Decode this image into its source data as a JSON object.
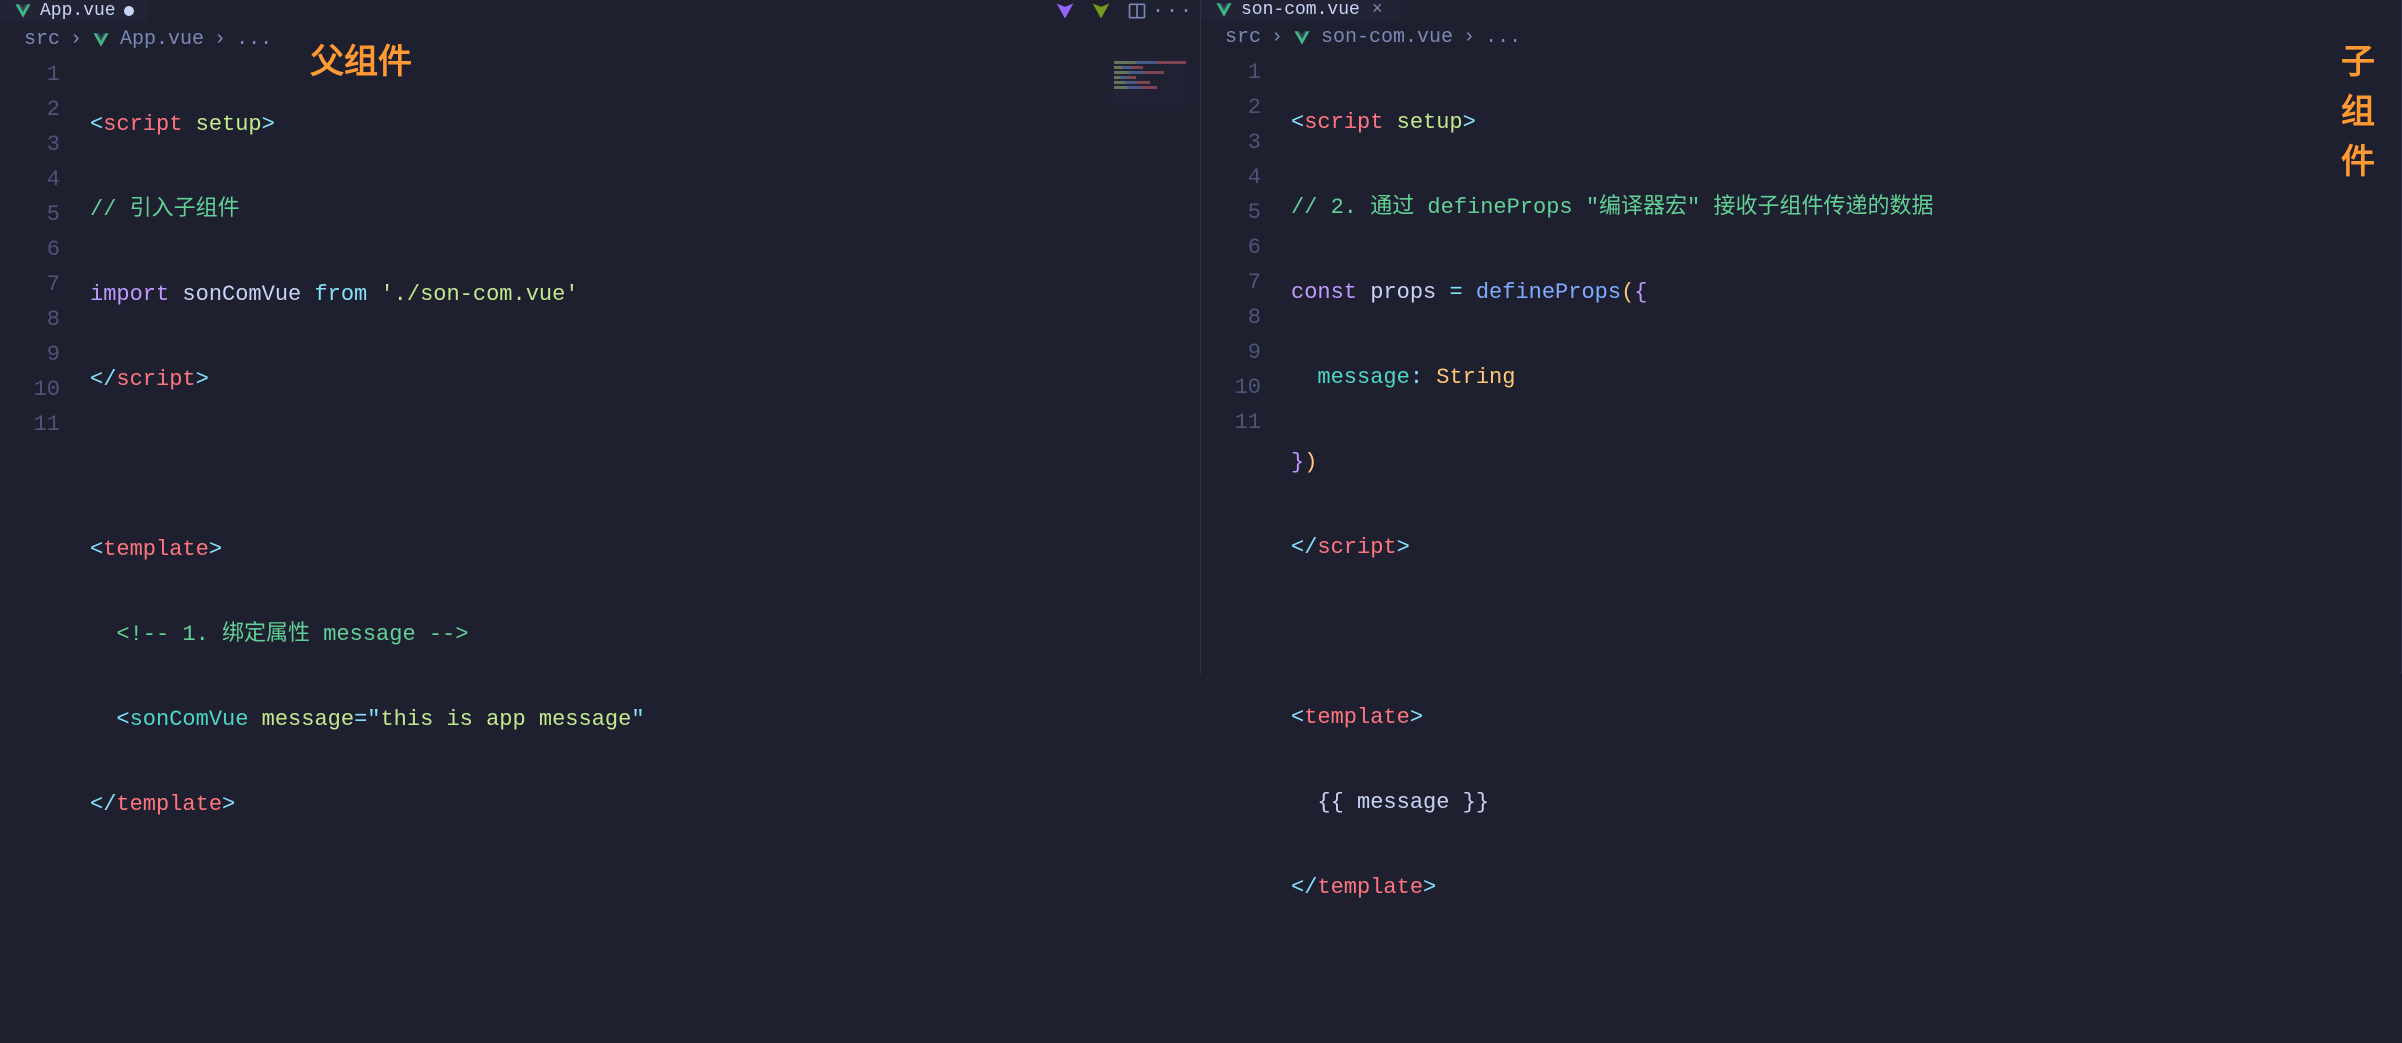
{
  "left": {
    "tab": {
      "name": "App.vue",
      "modified": true
    },
    "breadcrumb": {
      "root": "src",
      "file": "App.vue",
      "trail": "..."
    },
    "annotation": "父组件",
    "lines": [
      "1",
      "2",
      "3",
      "4",
      "5",
      "6",
      "7",
      "8",
      "9",
      "10",
      "11"
    ],
    "code": {
      "l1_open": "<",
      "l1_tag": "script",
      "l1_attr": " setup",
      "l1_close": ">",
      "l2": "// 引入子组件",
      "l3_kw": "import",
      "l3_name": " sonComVue ",
      "l3_from": "from",
      "l3_str": " './son-com.vue'",
      "l4_open": "</",
      "l4_tag": "script",
      "l4_close": ">",
      "l6_open": "<",
      "l6_tag": "template",
      "l6_close": ">",
      "l7": "<!-- 1. 绑定属性 message -->",
      "l8_open": "<",
      "l8_tag": "sonComVue",
      "l8_attr": " message",
      "l8_eq": "=",
      "l8_q1": "\"",
      "l8_val": "this is app message",
      "l8_q2": "\"",
      "l9_open": "</",
      "l9_tag": "template",
      "l9_close": ">"
    }
  },
  "right": {
    "tab": {
      "name": "son-com.vue"
    },
    "breadcrumb": {
      "root": "src",
      "file": "son-com.vue",
      "trail": "..."
    },
    "annotation": "子组件",
    "lines": [
      "1",
      "2",
      "3",
      "4",
      "5",
      "6",
      "7",
      "8",
      "9",
      "10",
      "11"
    ],
    "code": {
      "l1_open": "<",
      "l1_tag": "script",
      "l1_attr": " setup",
      "l1_close": ">",
      "l2": "// 2. 通过 defineProps \"编译器宏\" 接收子组件传递的数据",
      "l3_kw": "const",
      "l3_name": " props ",
      "l3_eq": "=",
      "l3_fn": " defineProps",
      "l3_p1": "(",
      "l3_b1": "{",
      "l4_prop": "message",
      "l4_colon": ": ",
      "l4_type": "String",
      "l5_b": "}",
      "l5_p": ")",
      "l6_open": "</",
      "l6_tag": "script",
      "l6_close": ">",
      "l8_open": "<",
      "l8_tag": "template",
      "l8_close": ">",
      "l9_b1": "{{ ",
      "l9_var": "message",
      "l9_b2": " }}",
      "l10_open": "</",
      "l10_tag": "template",
      "l10_close": ">"
    }
  }
}
